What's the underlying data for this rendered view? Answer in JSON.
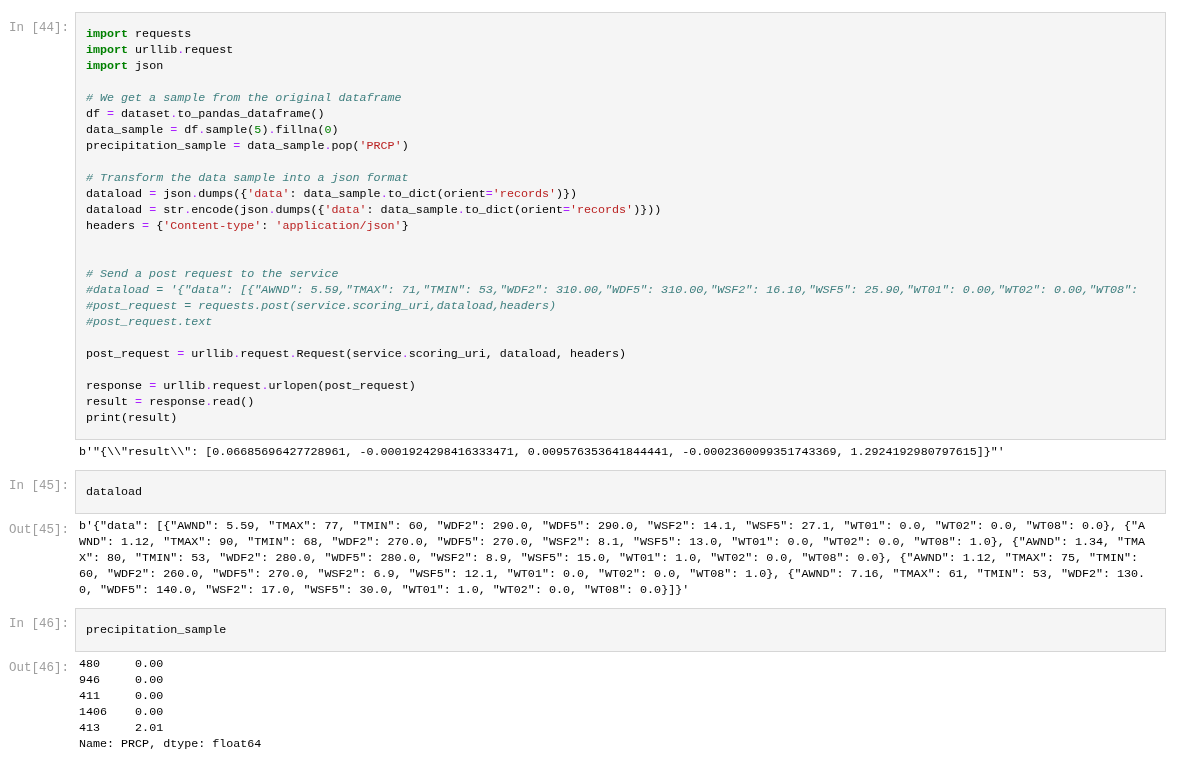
{
  "cells": [
    {
      "input_prompt": "In [44]:",
      "code": [
        {
          "kind": "code",
          "segments": [
            {
              "kind": "kw",
              "text": "import"
            },
            {
              "kind": "plain",
              "text": " requests"
            }
          ]
        },
        {
          "kind": "code",
          "segments": [
            {
              "kind": "kw",
              "text": "import"
            },
            {
              "kind": "plain",
              "text": " urllib"
            },
            {
              "kind": "op",
              "text": "."
            },
            {
              "kind": "plain",
              "text": "request"
            }
          ]
        },
        {
          "kind": "code",
          "segments": [
            {
              "kind": "kw",
              "text": "import"
            },
            {
              "kind": "plain",
              "text": " json"
            }
          ]
        },
        {
          "kind": "blank"
        },
        {
          "kind": "code",
          "segments": [
            {
              "kind": "comment",
              "text": "# We get a sample from the original dataframe"
            }
          ]
        },
        {
          "kind": "code",
          "segments": [
            {
              "kind": "plain",
              "text": "df "
            },
            {
              "kind": "op",
              "text": "="
            },
            {
              "kind": "plain",
              "text": " dataset"
            },
            {
              "kind": "op",
              "text": "."
            },
            {
              "kind": "plain",
              "text": "to_pandas_dataframe()"
            }
          ]
        },
        {
          "kind": "code",
          "segments": [
            {
              "kind": "plain",
              "text": "data_sample "
            },
            {
              "kind": "op",
              "text": "="
            },
            {
              "kind": "plain",
              "text": " df"
            },
            {
              "kind": "op",
              "text": "."
            },
            {
              "kind": "plain",
              "text": "sample("
            },
            {
              "kind": "num",
              "text": "5"
            },
            {
              "kind": "plain",
              "text": ")"
            },
            {
              "kind": "op",
              "text": "."
            },
            {
              "kind": "plain",
              "text": "fillna("
            },
            {
              "kind": "num",
              "text": "0"
            },
            {
              "kind": "plain",
              "text": ")"
            }
          ]
        },
        {
          "kind": "code",
          "segments": [
            {
              "kind": "plain",
              "text": "precipitation_sample "
            },
            {
              "kind": "op",
              "text": "="
            },
            {
              "kind": "plain",
              "text": " data_sample"
            },
            {
              "kind": "op",
              "text": "."
            },
            {
              "kind": "plain",
              "text": "pop("
            },
            {
              "kind": "str",
              "text": "'PRCP'"
            },
            {
              "kind": "plain",
              "text": ")"
            }
          ]
        },
        {
          "kind": "blank"
        },
        {
          "kind": "code",
          "segments": [
            {
              "kind": "comment",
              "text": "# Transform the data sample into a json format"
            }
          ]
        },
        {
          "kind": "code",
          "segments": [
            {
              "kind": "plain",
              "text": "dataload "
            },
            {
              "kind": "op",
              "text": "="
            },
            {
              "kind": "plain",
              "text": " json"
            },
            {
              "kind": "op",
              "text": "."
            },
            {
              "kind": "plain",
              "text": "dumps({"
            },
            {
              "kind": "str",
              "text": "'data'"
            },
            {
              "kind": "plain",
              "text": ": data_sample"
            },
            {
              "kind": "op",
              "text": "."
            },
            {
              "kind": "plain",
              "text": "to_dict(orient"
            },
            {
              "kind": "op",
              "text": "="
            },
            {
              "kind": "str",
              "text": "'records'"
            },
            {
              "kind": "plain",
              "text": ")})"
            }
          ]
        },
        {
          "kind": "code",
          "segments": [
            {
              "kind": "plain",
              "text": "dataload "
            },
            {
              "kind": "op",
              "text": "="
            },
            {
              "kind": "plain",
              "text": " str"
            },
            {
              "kind": "op",
              "text": "."
            },
            {
              "kind": "plain",
              "text": "encode(json"
            },
            {
              "kind": "op",
              "text": "."
            },
            {
              "kind": "plain",
              "text": "dumps({"
            },
            {
              "kind": "str",
              "text": "'data'"
            },
            {
              "kind": "plain",
              "text": ": data_sample"
            },
            {
              "kind": "op",
              "text": "."
            },
            {
              "kind": "plain",
              "text": "to_dict(orient"
            },
            {
              "kind": "op",
              "text": "="
            },
            {
              "kind": "str",
              "text": "'records'"
            },
            {
              "kind": "plain",
              "text": ")}))"
            }
          ]
        },
        {
          "kind": "code",
          "segments": [
            {
              "kind": "plain",
              "text": "headers "
            },
            {
              "kind": "op",
              "text": "="
            },
            {
              "kind": "plain",
              "text": " {"
            },
            {
              "kind": "str",
              "text": "'Content-type'"
            },
            {
              "kind": "plain",
              "text": ": "
            },
            {
              "kind": "str",
              "text": "'application/json'"
            },
            {
              "kind": "plain",
              "text": "}"
            }
          ]
        },
        {
          "kind": "blank"
        },
        {
          "kind": "blank"
        },
        {
          "kind": "code",
          "segments": [
            {
              "kind": "comment",
              "text": "# Send a post request to the service"
            }
          ]
        },
        {
          "kind": "code",
          "segments": [
            {
              "kind": "comment",
              "text": "#dataload = '{\"data\": [{\"AWND\": 5.59,\"TMAX\": 71,\"TMIN\": 53,\"WDF2\": 310.00,\"WDF5\": 310.00,\"WSF2\": 16.10,\"WSF5\": 25.90,\"WT01\": 0.00,\"WT02\": 0.00,\"WT08\":"
            }
          ]
        },
        {
          "kind": "code",
          "segments": [
            {
              "kind": "comment",
              "text": "#post_request = requests.post(service.scoring_uri,dataload,headers)"
            }
          ]
        },
        {
          "kind": "code",
          "segments": [
            {
              "kind": "comment",
              "text": "#post_request.text"
            }
          ]
        },
        {
          "kind": "blank"
        },
        {
          "kind": "code",
          "segments": [
            {
              "kind": "plain",
              "text": "post_request "
            },
            {
              "kind": "op",
              "text": "="
            },
            {
              "kind": "plain",
              "text": " urllib"
            },
            {
              "kind": "op",
              "text": "."
            },
            {
              "kind": "plain",
              "text": "request"
            },
            {
              "kind": "op",
              "text": "."
            },
            {
              "kind": "plain",
              "text": "Request(service"
            },
            {
              "kind": "op",
              "text": "."
            },
            {
              "kind": "plain",
              "text": "scoring_uri, dataload, headers)"
            }
          ]
        },
        {
          "kind": "blank"
        },
        {
          "kind": "code",
          "segments": [
            {
              "kind": "plain",
              "text": "response "
            },
            {
              "kind": "op",
              "text": "="
            },
            {
              "kind": "plain",
              "text": " urllib"
            },
            {
              "kind": "op",
              "text": "."
            },
            {
              "kind": "plain",
              "text": "request"
            },
            {
              "kind": "op",
              "text": "."
            },
            {
              "kind": "plain",
              "text": "urlopen(post_request)"
            }
          ]
        },
        {
          "kind": "code",
          "segments": [
            {
              "kind": "plain",
              "text": "result "
            },
            {
              "kind": "op",
              "text": "="
            },
            {
              "kind": "plain",
              "text": " response"
            },
            {
              "kind": "op",
              "text": "."
            },
            {
              "kind": "plain",
              "text": "read()"
            }
          ]
        },
        {
          "kind": "code",
          "segments": [
            {
              "kind": "plain",
              "text": "print(result)"
            }
          ]
        }
      ],
      "output": [
        "b'\"{\\\\\"result\\\\\": [0.06685696427728961, -0.0001924298416333471, 0.009576353641844441, -0.0002360099351743369, 1.2924192980797615]}\"'"
      ]
    },
    {
      "input_prompt": "In [45]:",
      "code": [
        {
          "kind": "code",
          "segments": [
            {
              "kind": "plain",
              "text": "dataload"
            }
          ]
        }
      ],
      "output_prompt": "Out[45]:",
      "output": [
        "b'{\"data\": [{\"AWND\": 5.59, \"TMAX\": 77, \"TMIN\": 60, \"WDF2\": 290.0, \"WDF5\": 290.0, \"WSF2\": 14.1, \"WSF5\": 27.1, \"WT01\": 0.0, \"WT02\": 0.0, \"WT08\": 0.0}, {\"A",
        "WND\": 1.12, \"TMAX\": 90, \"TMIN\": 68, \"WDF2\": 270.0, \"WDF5\": 270.0, \"WSF2\": 8.1, \"WSF5\": 13.0, \"WT01\": 0.0, \"WT02\": 0.0, \"WT08\": 1.0}, {\"AWND\": 1.34, \"TMA",
        "X\": 80, \"TMIN\": 53, \"WDF2\": 280.0, \"WDF5\": 280.0, \"WSF2\": 8.9, \"WSF5\": 15.0, \"WT01\": 1.0, \"WT02\": 0.0, \"WT08\": 0.0}, {\"AWND\": 1.12, \"TMAX\": 75, \"TMIN\":",
        "60, \"WDF2\": 260.0, \"WDF5\": 270.0, \"WSF2\": 6.9, \"WSF5\": 12.1, \"WT01\": 0.0, \"WT02\": 0.0, \"WT08\": 1.0}, {\"AWND\": 7.16, \"TMAX\": 61, \"TMIN\": 53, \"WDF2\": 130.",
        "0, \"WDF5\": 140.0, \"WSF2\": 17.0, \"WSF5\": 30.0, \"WT01\": 1.0, \"WT02\": 0.0, \"WT08\": 0.0}]}'"
      ]
    },
    {
      "input_prompt": "In [46]:",
      "code": [
        {
          "kind": "code",
          "segments": [
            {
              "kind": "plain",
              "text": "precipitation_sample"
            }
          ]
        }
      ],
      "output_prompt": "Out[46]:",
      "output": [
        "480     0.00",
        "946     0.00",
        "411     0.00",
        "1406    0.00",
        "413     2.01",
        "Name: PRCP, dtype: float64"
      ]
    }
  ]
}
